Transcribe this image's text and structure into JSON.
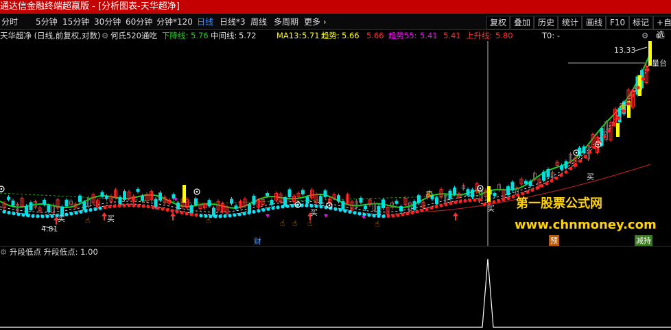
{
  "window": {
    "title": "通达信金融终端超赢版 - [分析图表-天华超净]",
    "minimize": "—",
    "maximize": "□",
    "close": "×"
  },
  "toolbar": {
    "periods": [
      "分时",
      "5分钟",
      "15分钟",
      "30分钟",
      "60分钟",
      "分钟*120",
      "日线",
      "日线*3",
      "周线",
      "多周期",
      "更多 ›"
    ],
    "active_period": "日线",
    "right_buttons": [
      "复权",
      "叠加",
      "历史",
      "统计",
      "画线",
      "F10",
      "标记",
      "+自选"
    ]
  },
  "legend": {
    "stock": "天华超净 (日线,前复权,对数)",
    "formula": "何氏520通吃",
    "down_line_label": "下降线:",
    "down_line_value": "5.76",
    "mid_line_label": "中间线:",
    "mid_line_value": "5.72",
    "ma13_label": "MA13:",
    "ma13_value": "5.71",
    "trend_label": "趋势:",
    "trend_value": "5.66",
    "trend_value2": "5.66",
    "trend55_label": "趋势55:",
    "trend55_value": "5.41",
    "trend55_value2": "5.41",
    "up_line_label": "上升线:",
    "up_line_value": "5.80",
    "t0": "T0: -"
  },
  "chart_annotations": {
    "price_high": "13.33",
    "price_low": "4.81",
    "liangtai": "量台",
    "buy": "买",
    "sell": "卖",
    "cai": "财",
    "yu": "预",
    "jiansheng": "减持"
  },
  "watermark": {
    "line1": "第一股票公式网",
    "line2": "www.chnmoney.com"
  },
  "indicator": {
    "name": "升段低点",
    "label": "升段低点:",
    "value": "1.00"
  },
  "colors": {
    "title_bg": "#c40000",
    "rising": "#ff3030",
    "falling": "#00e0e0",
    "green_line": "#20d020",
    "red_dots": "#ff2020",
    "cyan_dots": "#00e8ff",
    "yellow": "#ffff00",
    "magenta": "#ff00ff"
  }
}
